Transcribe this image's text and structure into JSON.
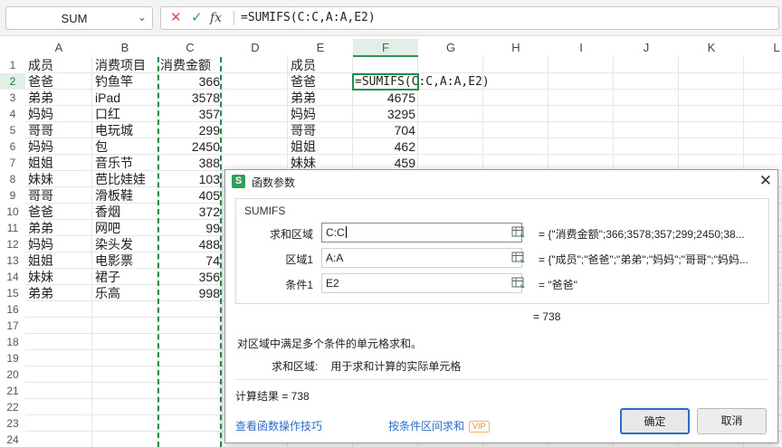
{
  "formula_bar": {
    "name_box": "SUM",
    "formula": "=SUMIFS(C:C,A:A,E2)"
  },
  "columns": [
    "A",
    "B",
    "C",
    "D",
    "E",
    "F",
    "G",
    "H",
    "I",
    "J",
    "K",
    "L"
  ],
  "rows": [
    "1",
    "2",
    "3",
    "4",
    "5",
    "6",
    "7",
    "8",
    "9",
    "10",
    "11",
    "12",
    "13",
    "14",
    "15",
    "16",
    "17",
    "18",
    "19",
    "20",
    "21",
    "22",
    "23",
    "24"
  ],
  "sheet": {
    "col_a": [
      "成员",
      "爸爸",
      "弟弟",
      "妈妈",
      "哥哥",
      "妈妈",
      "姐姐",
      "妹妹",
      "哥哥",
      "爸爸",
      "弟弟",
      "妈妈",
      "姐姐",
      "妹妹",
      "弟弟"
    ],
    "col_b": [
      "消费项目",
      "钓鱼竿",
      "iPad",
      "口红",
      "电玩城",
      "包",
      "音乐节",
      "芭比娃娃",
      "滑板鞋",
      "香烟",
      "网吧",
      "染头发",
      "电影票",
      "裙子",
      "乐高"
    ],
    "col_c_header": "消费金额",
    "col_c": [
      "366",
      "3578",
      "357",
      "299",
      "2450",
      "388",
      "103",
      "405",
      "372",
      "99",
      "488",
      "74",
      "356",
      "998"
    ],
    "col_e": [
      "成员",
      "爸爸",
      "弟弟",
      "妈妈",
      "哥哥",
      "姐姐",
      "妹妹"
    ],
    "col_f": [
      "4675",
      "3295",
      "704",
      "462",
      "459"
    ],
    "active_cell_text": "=SUMIFS(C:C,A:A,E2)"
  },
  "dialog": {
    "title": "函数参数",
    "function_name": "SUMIFS",
    "args": [
      {
        "label": "求和区域",
        "value": "C:C",
        "result": "= {\"消费金额\";366;3578;357;299;2450;38..."
      },
      {
        "label": "区域1",
        "value": "A:A",
        "result": "= {\"成员\";\"爸爸\";\"弟弟\";\"妈妈\";\"哥哥\";\"妈妈..."
      },
      {
        "label": "条件1",
        "value": "E2",
        "result": "= \"爸爸\""
      }
    ],
    "total": "= 738",
    "description": "对区域中满足多个条件的单元格求和。",
    "param_name": "求和区域:",
    "param_desc": "用于求和计算的实际单元格",
    "calc_result": "计算结果 = 738",
    "tips_link": "查看函数操作技巧",
    "range_link": "按条件区间求和",
    "vip": "VIP",
    "ok": "确定",
    "cancel": "取消"
  }
}
